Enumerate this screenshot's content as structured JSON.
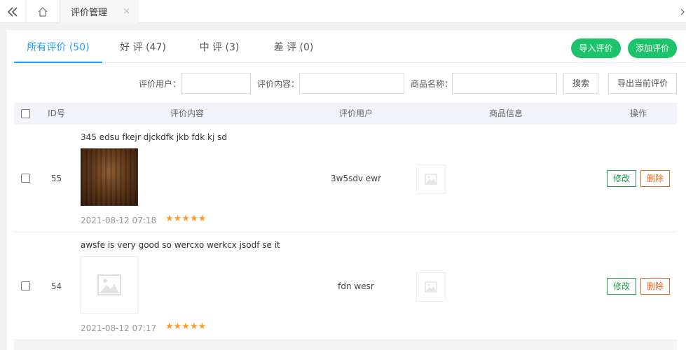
{
  "topbar": {
    "collapse_icon": "double-chevron-left-icon",
    "home_icon": "home-icon",
    "tab_label": "评价管理",
    "tab_close": "×"
  },
  "tabs": [
    {
      "label": "所有评价 (50)",
      "active": true
    },
    {
      "label": "好 评 (47)",
      "active": false
    },
    {
      "label": "中 评 (3)",
      "active": false
    },
    {
      "label": "差 评 (0)",
      "active": false
    }
  ],
  "actions": {
    "import_label": "导入评价",
    "add_label": "添加评价"
  },
  "search": {
    "user_label": "评价用户：",
    "user_value": "",
    "content_label": "评价内容：",
    "content_value": "",
    "product_label": "商品名称：",
    "product_value": "",
    "search_label": "搜索",
    "export_label": "导出当前评价"
  },
  "table": {
    "headers": {
      "id": "ID号",
      "content": "评价内容",
      "user": "评价用户",
      "product": "商品信息",
      "ops": "操作"
    },
    "rows": [
      {
        "id": "55",
        "text": "345 edsu fkejr djckdfk jkb fdk kj sd",
        "date": "2021-08-12 07:18",
        "stars": "★★★★★",
        "user": "3w5sdv ewr",
        "edit": "修改",
        "delete": "删除"
      },
      {
        "id": "54",
        "text": "awsfe is very good so wercxo werkcx jsodf se it",
        "date": "2021-08-12 07:17",
        "stars": "★★★★★",
        "user": "fdn wesr",
        "edit": "修改",
        "delete": "删除"
      }
    ]
  },
  "colors": {
    "accent": "#1e9fff",
    "green": "#1dc36a",
    "star": "#ff9a2e",
    "edit": "#1aa34a",
    "delete": "#e36b1c"
  }
}
